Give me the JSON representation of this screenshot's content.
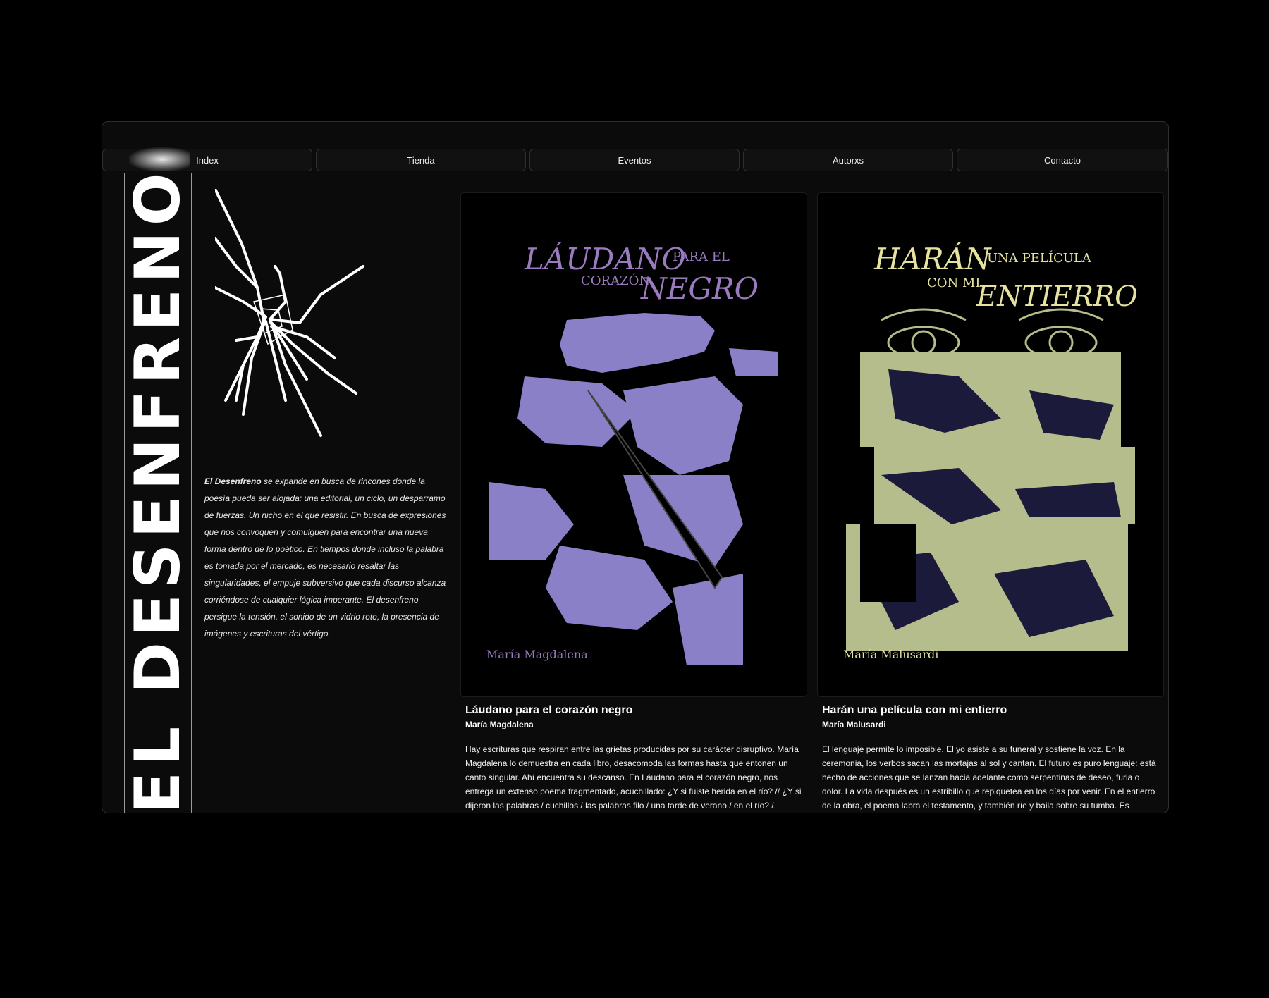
{
  "nav": {
    "items": [
      {
        "label": "Index"
      },
      {
        "label": "Tienda"
      },
      {
        "label": "Eventos"
      },
      {
        "label": "Autorxs"
      },
      {
        "label": "Contacto"
      }
    ]
  },
  "brand": {
    "vertical_text": "EL DESENFRENO EL D"
  },
  "intro": {
    "bold": "El Desenfreno",
    "text": " se expande en busca de rincones donde la poesía pueda ser alojada: una editorial, un ciclo, un desparramo de fuerzas. Un nicho en el que resistir. En busca de expresiones que nos convoquen y comulguen para encontrar una nueva forma dentro de lo poético. En tiempos donde incluso la palabra es tomada por el mercado, es necesario resaltar las singularidades, el empuje subversivo que cada discurso alcanza corriéndose de cualquier lógica imperante. El desenfreno persigue la tensión, el sonido de un vidrio roto, la presencia de imágenes y escrituras del vértigo."
  },
  "books": [
    {
      "cover": {
        "line1": "LÁUDANO",
        "line2": "PARA EL",
        "line3": "CORAZÓN",
        "line4": "NEGRO",
        "author": "María Magdalena",
        "color": "#9b7bc0",
        "art_color": "#8a80c8"
      },
      "title": "Láudano para el corazón negro",
      "author": "María Magdalena",
      "description": "Hay escrituras que respiran entre las grietas producidas por su carácter disruptivo. María Magdalena lo demuestra en cada libro, desacomoda las formas hasta que entonen un canto singular. Ahí encuentra su descanso. En Láudano para el corazón negro, nos entrega un extenso poema fragmentado, acuchillado: ¿Y si fuiste herida en el río? // ¿Y si dijeron las palabras / cuchillos / las palabras filo / una tarde de verano / en el río? /."
    },
    {
      "cover": {
        "line1": "HARÁN",
        "line2": "UNA PELÍCULA",
        "line3": "CON MI",
        "line4": "ENTIERRO",
        "author": "María Malusardi",
        "color": "#e6e2a0",
        "art_color": "#b5bd8c"
      },
      "title": "Harán una película con mi entierro",
      "author": "María Malusardi",
      "description": "El lenguaje permite lo imposible. El yo asiste a su funeral y sostiene la voz. En la ceremonia, los verbos sacan las mortajas al sol y cantan. El futuro es puro lenguaje: está hecho de acciones que se lanzan hacia adelante como serpentinas de deseo, furia o dolor. La vida después es un estribillo que repiquetea en los días por venir. En el entierro de la obra, el poema labra el testamento, y también ríe y baila sobre su tumba. Es"
    }
  ]
}
